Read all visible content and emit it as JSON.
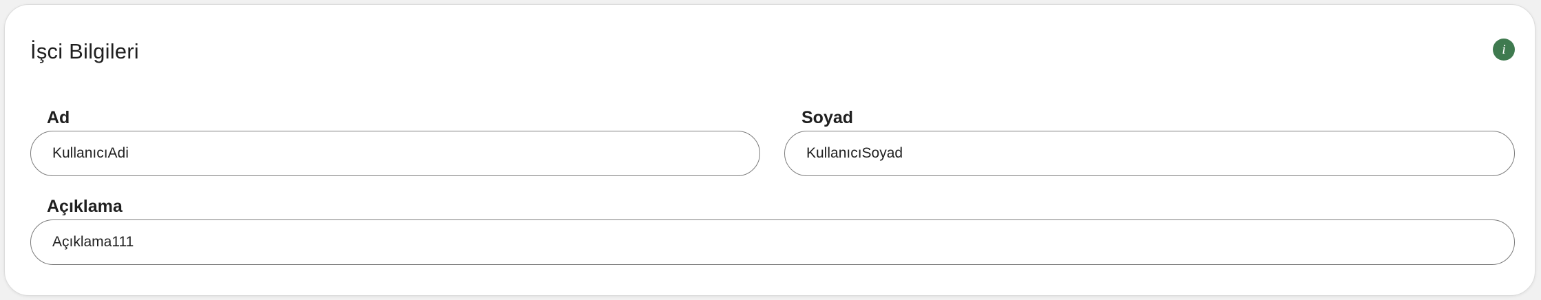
{
  "card": {
    "title": "İşci Bilgileri",
    "info_icon": "info-icon",
    "info_glyph": "i",
    "accent_color": "#3f7a4f"
  },
  "fields": {
    "first_name": {
      "label": "Ad",
      "value": "KullanıcıAdi"
    },
    "last_name": {
      "label": "Soyad",
      "value": "KullanıcıSoyad"
    },
    "description": {
      "label": "Açıklama",
      "value": "Açıklama111"
    }
  }
}
